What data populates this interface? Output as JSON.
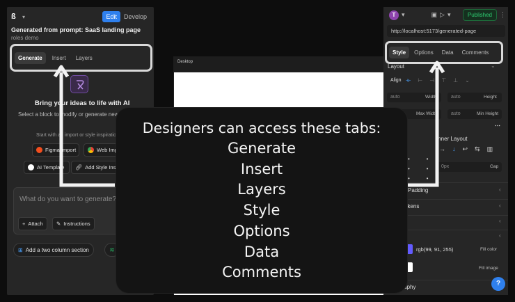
{
  "left_panel": {
    "mode_edit": "Edit",
    "mode_develop": "Develop",
    "title": "Generated from prompt: SaaS landing page",
    "subtitle": "roles demo",
    "tabs": [
      {
        "label": "Generate",
        "active": true
      },
      {
        "label": "Insert",
        "active": false
      },
      {
        "label": "Layers",
        "active": false
      }
    ],
    "heading": "Bring your ideas to life with AI",
    "select_hint": "Select a block to modify or generate new",
    "start_hint": "Start with an import or style inspiration",
    "actions": [
      {
        "label": "Figma Import",
        "icon": "figma-icon"
      },
      {
        "label": "Web Import",
        "icon": "chrome-icon"
      },
      {
        "label": "AI Template",
        "icon": "ai-template-icon"
      },
      {
        "label": "Add Style Inspiration",
        "icon": "link-icon"
      }
    ],
    "prompt_placeholder": "What do you want to generate?",
    "attach_label": "Attach",
    "instructions_label": "Instructions",
    "suggestion_chip": "Add a two column section"
  },
  "canvas": {
    "label": "Desktop"
  },
  "right_panel": {
    "avatar_initial": "T",
    "published_label": "Published",
    "url": "http://localhost:5173/generated-page",
    "tabs": [
      {
        "label": "Style",
        "active": true
      },
      {
        "label": "Options",
        "active": false
      },
      {
        "label": "Data",
        "active": false
      },
      {
        "label": "Comments",
        "active": false
      }
    ],
    "layout_label": "Layout",
    "align_label": "Align",
    "fields": {
      "width_value": "auto",
      "width_label": "Width",
      "height_value": "auto",
      "height_label": "Height",
      "max_width_value": "auto",
      "max_width_label": "Max Width",
      "min_height_value": "auto",
      "min_height_label": "Min Height",
      "gap_value": "0px",
      "gap_label": "Gap"
    },
    "inner_layout_label": "Inner Layout",
    "align_partial": "gn",
    "padding_label": "Padding",
    "tokens_label": "Tokens",
    "fill_label_partial": "nd",
    "fill_color_value": "rgb(99, 91, 255)",
    "fill_color_label": "Fill color",
    "fill_color_hex": "#635bff",
    "fill_image_label": "Fill image",
    "typography_partial": "graphy",
    "more_icon": "⋯",
    "help_label": "?"
  },
  "overlay": {
    "heading": "Designers can access these tabs:",
    "items": [
      "Generate",
      "Insert",
      "Layers",
      "Style",
      "Options",
      "Data",
      "Comments"
    ]
  }
}
